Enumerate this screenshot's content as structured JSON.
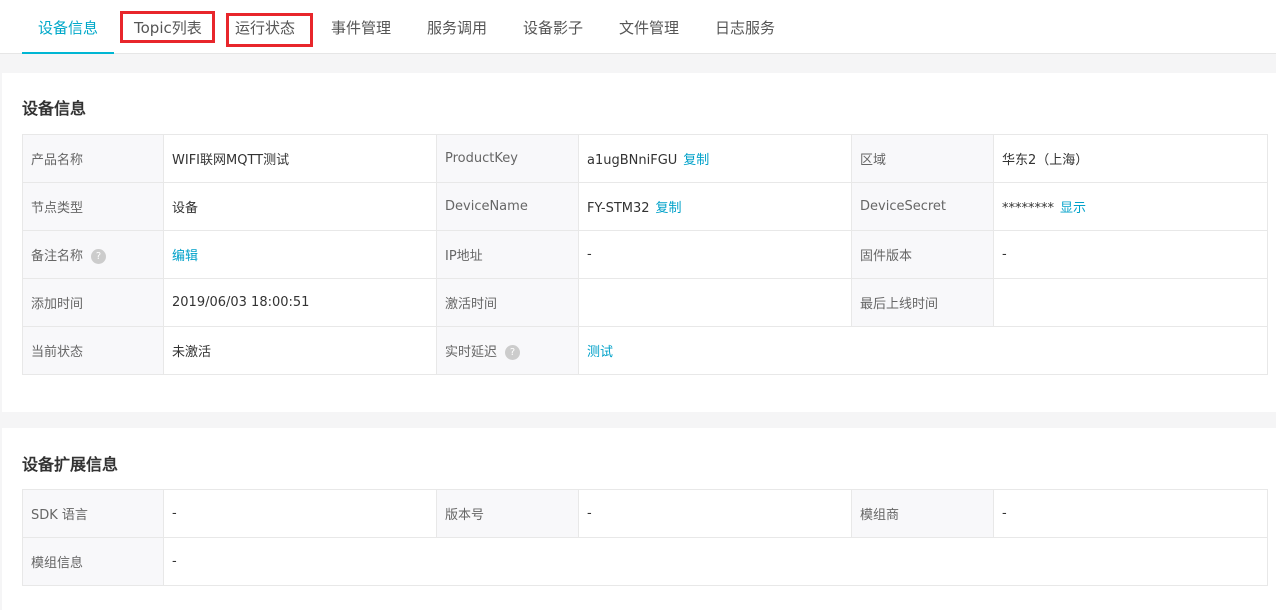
{
  "tabs": [
    "设备信息",
    "Topic列表",
    "运行状态",
    "事件管理",
    "服务调用",
    "设备影子",
    "文件管理",
    "日志服务"
  ],
  "device_info": {
    "title": "设备信息",
    "product_name_label": "产品名称",
    "product_name": "WIFI联网MQTT测试",
    "product_key_label": "ProductKey",
    "product_key": "a1ugBNniFGU",
    "region_label": "区域",
    "region": "华东2（上海）",
    "node_type_label": "节点类型",
    "node_type": "设备",
    "device_name_label": "DeviceName",
    "device_name": "FY-STM32",
    "device_secret_label": "DeviceSecret",
    "device_secret": "********",
    "show_label": "显示",
    "remark_label": "备注名称",
    "edit_label": "编辑",
    "ip_label": "IP地址",
    "ip": "-",
    "firmware_label": "固件版本",
    "firmware": "-",
    "added_label": "添加时间",
    "added": "2019/06/03 18:00:51",
    "activated_label": "激活时间",
    "last_online_label": "最后上线时间",
    "status_label": "当前状态",
    "status": "未激活",
    "latency_label": "实时延迟",
    "test_label": "测试",
    "copy_label": "复制",
    "help_glyph": "?"
  },
  "ext_info": {
    "title": "设备扩展信息",
    "sdk_label": "SDK 语言",
    "sdk": "-",
    "version_label": "版本号",
    "version": "-",
    "vendor_label": "模组商",
    "vendor": "-",
    "module_label": "模组信息",
    "module": "-"
  },
  "colors": {
    "accent": "#00a1c9",
    "highlight": "#e8262b"
  }
}
